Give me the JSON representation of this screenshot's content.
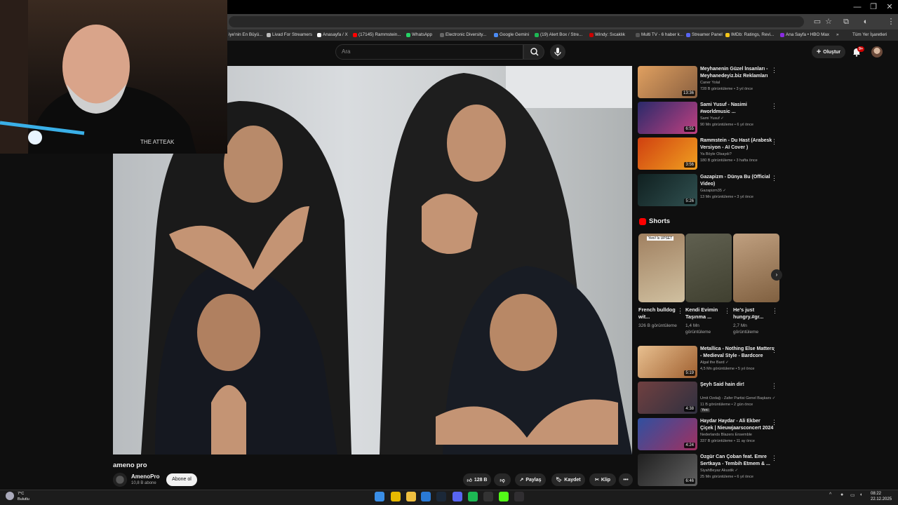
{
  "window": {
    "minimize": "—",
    "maximize": "❐",
    "close": "✕"
  },
  "bookmarks": [
    {
      "label": "iye'nin En Büyü...",
      "color": "#888"
    },
    {
      "label": "Livad For Streamers",
      "color": "#bbb"
    },
    {
      "label": "Anasayfa / X",
      "color": "#fff"
    },
    {
      "label": "(17145) Rammstein...",
      "color": "#f00"
    },
    {
      "label": "WhatsApp",
      "color": "#25d366"
    },
    {
      "label": "Electronic Diversity...",
      "color": "#666"
    },
    {
      "label": "Google Gemini",
      "color": "#4b8bf4"
    },
    {
      "label": "(19) Alert Box / Stre...",
      "color": "#1db954"
    },
    {
      "label": "Windy: Sıcaklık",
      "color": "#c00"
    },
    {
      "label": "Multi TV - 6 haber k...",
      "color": "#555"
    },
    {
      "label": "Streamer Panel",
      "color": "#5865f2"
    },
    {
      "label": "IMDb: Ratings, Revi...",
      "color": "#f5c518"
    },
    {
      "label": "Ana Sayfa • HBO Max",
      "color": "#8a2be2"
    }
  ],
  "bookmarks_overflow": "»",
  "all_bookmarks": "Tüm Yer İşaretleri",
  "search": {
    "placeholder": "Ara"
  },
  "header": {
    "create_label": "Oluştur",
    "notif_count": "9+"
  },
  "video": {
    "title": "ameno pro",
    "channel": "AmenoPro",
    "subs": "10,8 B abone",
    "subscribe_label": "Abone ol",
    "likes": "128 B",
    "share_label": "Paylaş",
    "save_label": "Kaydet",
    "clip_label": "Klip",
    "more_label": "•••"
  },
  "webcam": {
    "shirt_text": "THE ATTEAK"
  },
  "recommendations_top": [
    {
      "title": "Meyhanenin Güzel İnsanları - Meyhanedeyiz.biz Reklamları",
      "channel": "Caner Yolal",
      "stats": "728 B görüntüleme • 3 yıl önce",
      "duration": "13:36",
      "colors": [
        "#e0a060",
        "#8a6040"
      ]
    },
    {
      "title": "Sami Yusuf - Nasimi #worldmusic ...",
      "channel": "Sami Yusuf ✓",
      "stats": "90 Mn görüntüleme • 6 yıl önce",
      "duration": "6:55",
      "colors": [
        "#2a2a6a",
        "#c04080"
      ]
    },
    {
      "title": "Rammstein - Du Hast (Arabesk Versiyon - AI Cover )",
      "channel": "Ya Böyle Olsaydı?",
      "stats": "180 B görüntüleme • 3 hafta önce",
      "duration": "3:56",
      "colors": [
        "#d04010",
        "#f0a020"
      ]
    },
    {
      "title": "Gazapizm - Dünya Bu (Official Video)",
      "channel": "Gazapizm35 ✓",
      "stats": "13 Mn görüntüleme • 3 yıl önce",
      "duration": "5:26",
      "colors": [
        "#102020",
        "#305050"
      ]
    }
  ],
  "shorts_heading": "Shorts",
  "shorts": [
    {
      "title": "French bulldog wit...",
      "views": "326 B görüntüleme",
      "tag": "Yeni! İs UPSET",
      "colors": [
        "#a08060",
        "#d0c0a0"
      ]
    },
    {
      "title": "Kendi Evimin Taşınma ...",
      "views": "1,4 Mn görüntüleme",
      "tag": "",
      "colors": [
        "#606050",
        "#404030"
      ]
    },
    {
      "title": "He's just hungry.#gr...",
      "views": "2,7 Mn görüntüleme",
      "tag": "",
      "colors": [
        "#c0a080",
        "#806040"
      ]
    }
  ],
  "recommendations_bottom": [
    {
      "title": "Metallica - Nothing Else Matters - Medieval Style - Bardcore",
      "channel": "Algal the Bard ✓",
      "stats": "4,5 Mn görüntüleme • 5 yıl önce",
      "duration": "5:19",
      "colors": [
        "#e8c090",
        "#a06030"
      ],
      "badge": ""
    },
    {
      "title": "Şeyh Said hain dir!",
      "channel": "Ümit Özdağ - Zafer Partisi Genel Başkanı ✓",
      "stats": "11 B görüntüleme • 2 gün önce",
      "duration": "4:38",
      "colors": [
        "#704040",
        "#303040"
      ],
      "badge": "Yeni"
    },
    {
      "title": "Haydar Haydar - Ali Ekber Çiçek | Nieuwjaarsconcert 2024 | ...",
      "channel": "Nederlands Blazers Ensemble",
      "stats": "337 B görüntüleme • 11 ay önce",
      "duration": "4:24",
      "colors": [
        "#3050a0",
        "#a03060"
      ],
      "badge": ""
    },
    {
      "title": "Özgür Can Çoban feat. Emre Sertkaya - Tembih Etmem & ...",
      "channel": "SiyahBeyaz Akustik ✓",
      "stats": "25 Mn görüntüleme • 6 yıl önce",
      "duration": "6:46",
      "colors": [
        "#202020",
        "#606060"
      ],
      "badge": ""
    }
  ],
  "taskbar": {
    "weather_temp": "7°C",
    "weather_desc": "Bulutlu",
    "time": "08:22",
    "date": "22.12.2025",
    "apps": [
      {
        "name": "windows-start-icon",
        "color": "#3a8ee6"
      },
      {
        "name": "chrome-icon",
        "color": "#e6b800"
      },
      {
        "name": "file-explorer-icon",
        "color": "#f0c040"
      },
      {
        "name": "edge-icon",
        "color": "#2a7ad6"
      },
      {
        "name": "steam-icon",
        "color": "#1b2838"
      },
      {
        "name": "discord-icon",
        "color": "#5865f2"
      },
      {
        "name": "spotify-icon",
        "color": "#1db954"
      },
      {
        "name": "epic-games-icon",
        "color": "#333"
      },
      {
        "name": "kick-icon",
        "color": "#53fc18"
      },
      {
        "name": "obs-icon",
        "color": "#302e31"
      }
    ]
  }
}
